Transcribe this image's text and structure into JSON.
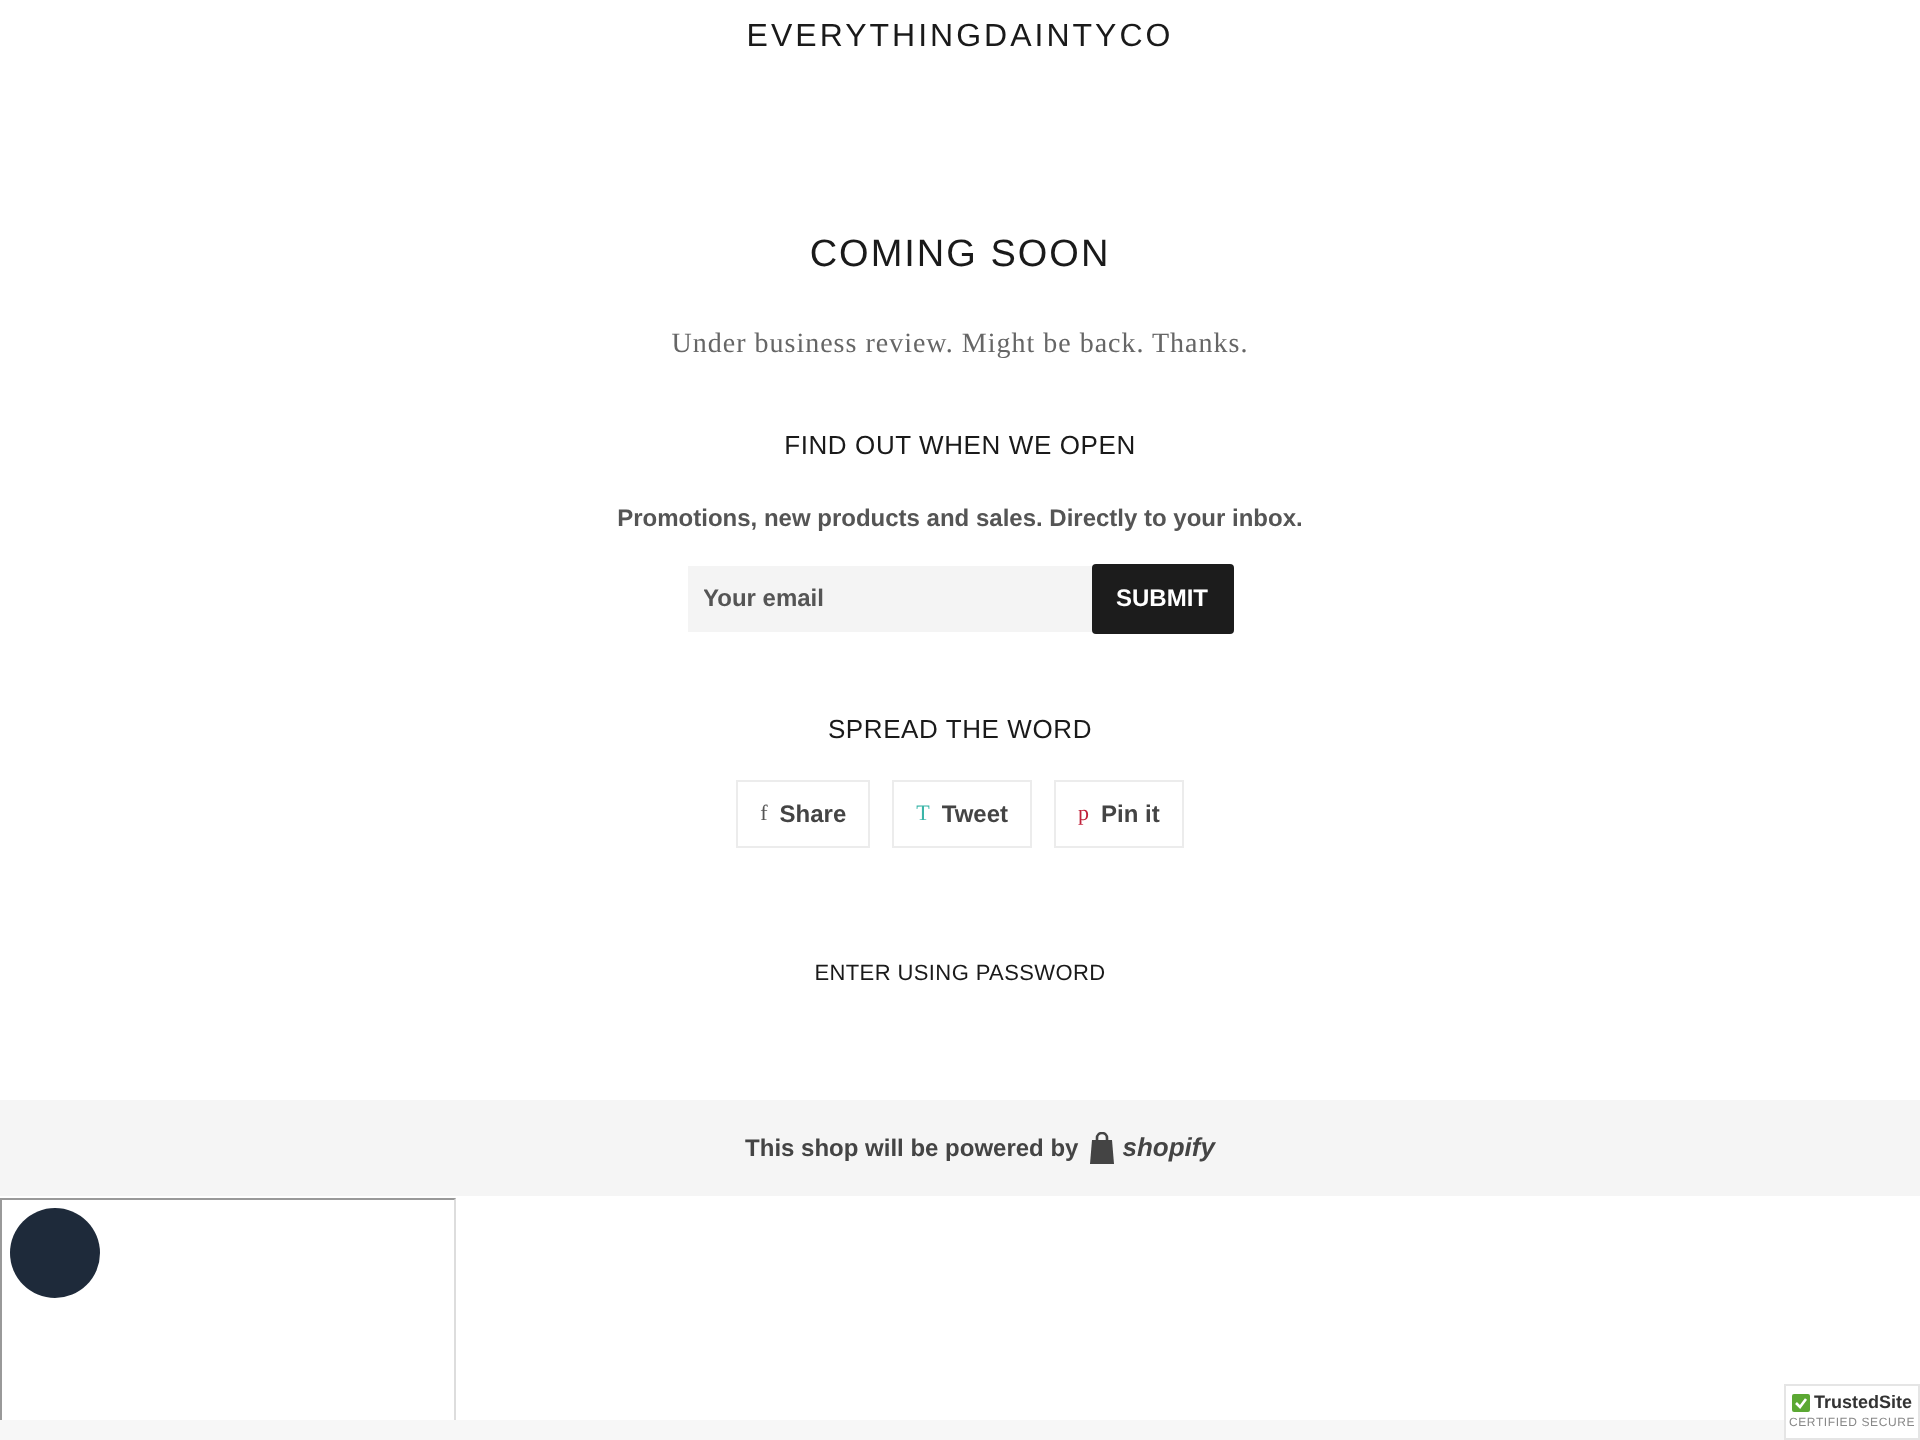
{
  "header": {
    "store_name": "EVERYTHINGDAINTYCO"
  },
  "main": {
    "title": "COMING SOON",
    "message": "Under business review. Might be back. Thanks.",
    "signup_heading": "FIND OUT WHEN WE OPEN",
    "signup_text": "Promotions, new products and sales. Directly to your inbox.",
    "email_placeholder": "Your email",
    "submit_label": "SUBMIT",
    "share_heading": "SPREAD THE WORD",
    "share_buttons": [
      {
        "glyph": "f",
        "label": "Share",
        "color": "#555555"
      },
      {
        "glyph": "T",
        "label": "Tweet",
        "color": "#3ab5a8"
      },
      {
        "glyph": "p",
        "label": "Pin it",
        "color": "#c0203a"
      }
    ],
    "password_link": "ENTER USING PASSWORD"
  },
  "footer": {
    "powered_text": "This shop will be powered by",
    "brand": "shopify"
  },
  "trust_badge": {
    "name": "TrustedSite",
    "subtitle": "CERTIFIED SECURE"
  }
}
